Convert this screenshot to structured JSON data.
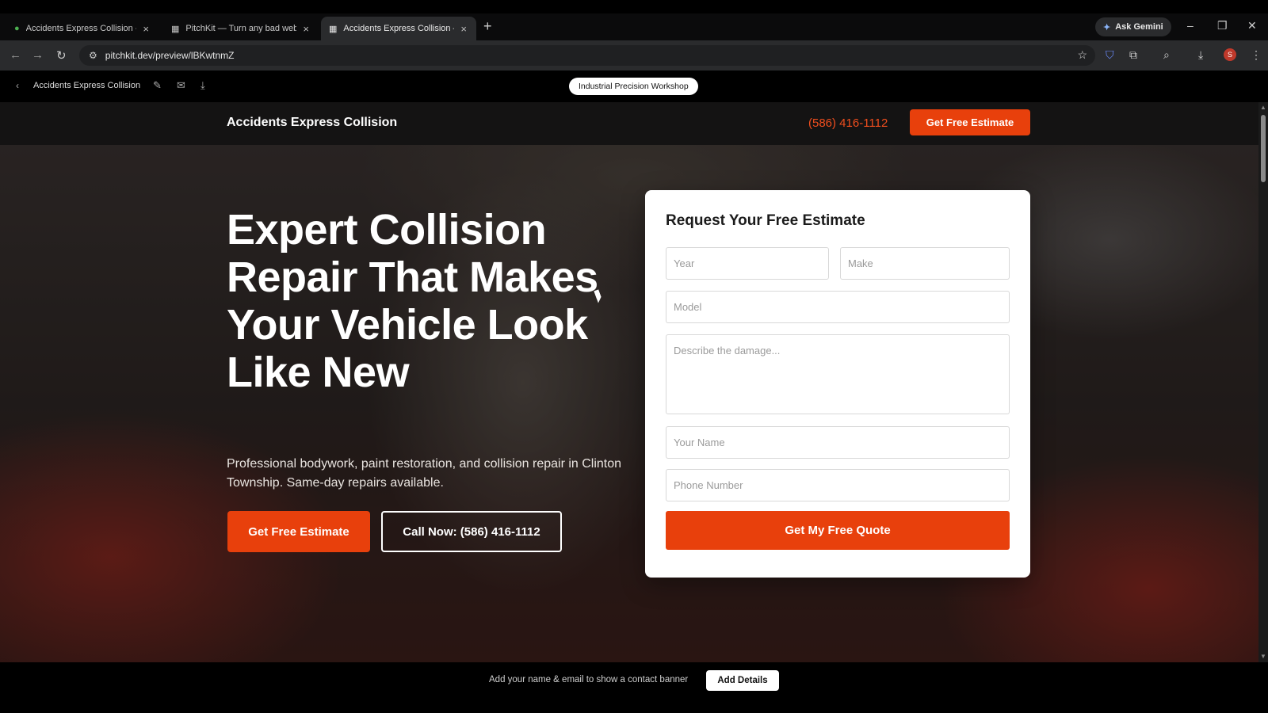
{
  "browser": {
    "tabs": [
      {
        "title": "Accidents Express Collision - Go",
        "icon": "map-pin-icon"
      },
      {
        "title": "PitchKit — Turn any bad website",
        "icon": "grid-icon"
      },
      {
        "title": "Accidents Express Collision — P",
        "icon": "grid-icon"
      }
    ],
    "ask_gemini": "Ask Gemini",
    "url": "pitchkit.dev/preview/lBKwtnmZ"
  },
  "pitchkit": {
    "site_name": "Accidents Express Collision",
    "theme_label": "Industrial Precision Workshop",
    "banner_text": "Add your name & email to show a contact banner",
    "banner_button": "Add Details"
  },
  "site": {
    "nav": {
      "brand": "Accidents Express Collision",
      "phone": "(586) 416-1112",
      "cta": "Get Free Estimate"
    },
    "hero": {
      "headline": "Expert Collision Repair That Makes Your Vehicle Look Like New",
      "subhead": "Professional bodywork, paint restoration, and collision repair in Clinton Township. Same-day repairs available.",
      "primary_cta": "Get Free Estimate",
      "secondary_cta": "Call Now: (586) 416-1112"
    },
    "form": {
      "title": "Request Your Free Estimate",
      "year_placeholder": "Year",
      "make_placeholder": "Make",
      "model_placeholder": "Model",
      "damage_placeholder": "Describe the damage...",
      "name_placeholder": "Your Name",
      "phone_placeholder": "Phone Number",
      "submit": "Get My Free Quote"
    }
  },
  "colors": {
    "accent": "#e8400c",
    "nav_bg": "#141313"
  }
}
